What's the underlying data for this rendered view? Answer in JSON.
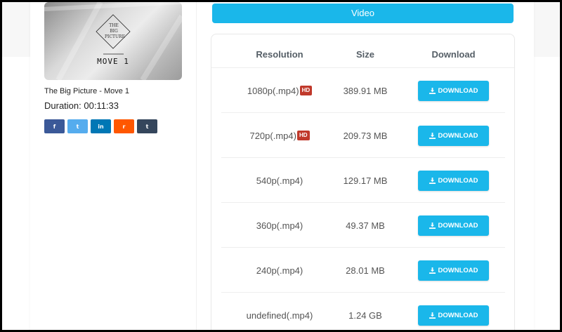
{
  "video": {
    "title": "The Big Picture - Move 1",
    "duration": "Duration: 00:11:33",
    "thumbnail": {
      "title_lines": [
        "THE",
        "BIG",
        "PICTURE"
      ],
      "move_label": "MOVE 1"
    }
  },
  "share": [
    {
      "name": "facebook",
      "glyph": "f",
      "color": "#3b5998"
    },
    {
      "name": "twitter",
      "glyph": "t",
      "color": "#55acee"
    },
    {
      "name": "linkedin",
      "glyph": "in",
      "color": "#0077b5"
    },
    {
      "name": "reddit",
      "glyph": "r",
      "color": "#ff5700"
    },
    {
      "name": "tumblr",
      "glyph": "t",
      "color": "#35465c"
    }
  ],
  "section_title": "Video",
  "table": {
    "headers": {
      "resolution": "Resolution",
      "size": "Size",
      "download": "Download"
    },
    "download_label": "DOWNLOAD",
    "hd_label": "HD",
    "rows": [
      {
        "resolution": "1080p(.mp4)",
        "hd": true,
        "size": "389.91 MB"
      },
      {
        "resolution": "720p(.mp4)",
        "hd": true,
        "size": "209.73 MB"
      },
      {
        "resolution": "540p(.mp4)",
        "hd": false,
        "size": "129.17 MB"
      },
      {
        "resolution": "360p(.mp4)",
        "hd": false,
        "size": "49.37 MB"
      },
      {
        "resolution": "240p(.mp4)",
        "hd": false,
        "size": "28.01 MB"
      },
      {
        "resolution": "undefined(.mp4)",
        "hd": false,
        "size": "1.24 GB"
      }
    ]
  },
  "colors": {
    "accent": "#1ab7ea",
    "hd_badge": "#c0392b"
  }
}
